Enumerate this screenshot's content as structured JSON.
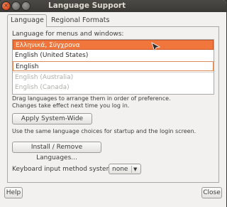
{
  "window": {
    "title": "Language Support"
  },
  "tabs": [
    {
      "label": "Language"
    },
    {
      "label": "Regional Formats"
    }
  ],
  "language_section": {
    "heading": "Language for menus and windows:",
    "languages": [
      "Ελληνικά, Σύγχρονα",
      "English (United States)",
      "English",
      "English (Australia)",
      "English (Canada)"
    ],
    "hint_line1": "Drag languages to arrange them in order of preference.",
    "hint_line2": "Changes take effect next time you log in."
  },
  "apply_button": {
    "label": "Apply System-Wide"
  },
  "apply_hint": "Use the same language choices for startup and the login screen.",
  "install_button": {
    "label": "Install / Remove Languages..."
  },
  "keyboard": {
    "label": "Keyboard input method system:",
    "value": "none"
  },
  "footer": {
    "help_label": "Help",
    "close_label": "Close"
  },
  "icons": {
    "close": "close-icon",
    "minimize": "minimize-icon",
    "maximize": "maximize-icon",
    "dropdown": "chevron-down-icon",
    "pointer": "mouse-pointer-icon"
  }
}
